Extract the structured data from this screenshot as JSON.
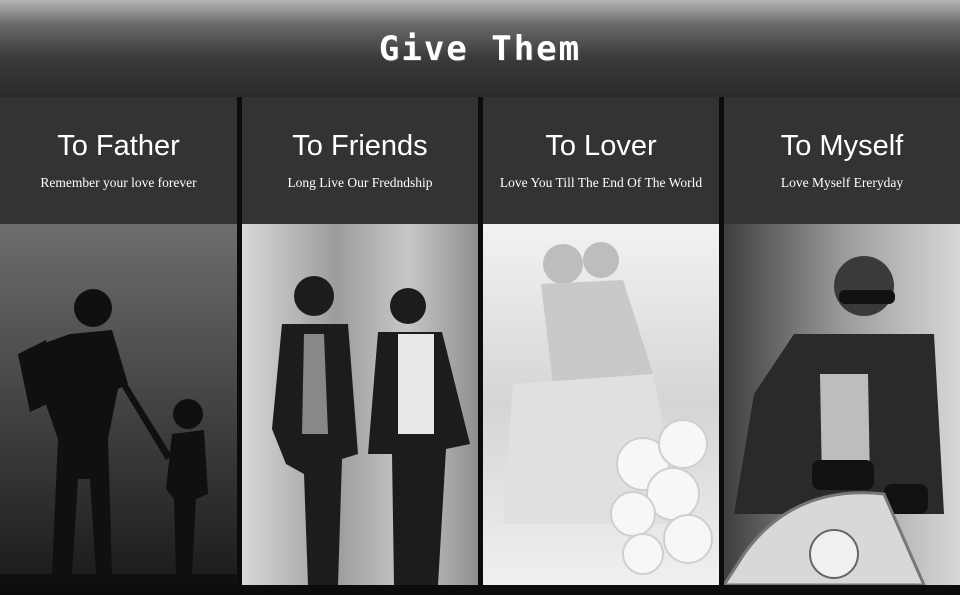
{
  "header": {
    "title": "Give Them"
  },
  "panels": [
    {
      "title": "To Father",
      "subtitle": "Remember your love forever",
      "image_icon": "father-and-child-silhouette"
    },
    {
      "title": "To Friends",
      "subtitle": "Long Live Our Fredndship",
      "image_icon": "two-men-in-suits"
    },
    {
      "title": "To Lover",
      "subtitle": "Love You Till The End Of  The  World",
      "image_icon": "bride-with-flowers"
    },
    {
      "title": "To Myself",
      "subtitle": "Love Myself  Ereryday",
      "image_icon": "man-on-motorcycle"
    }
  ]
}
